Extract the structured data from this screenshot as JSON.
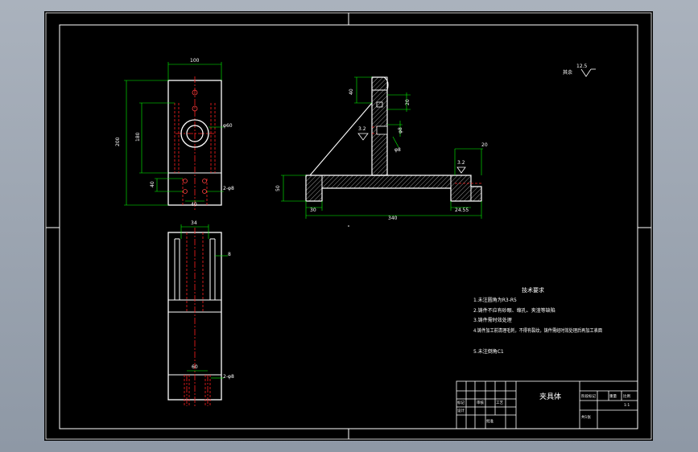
{
  "colors": {
    "paper": "#000000",
    "frame": "#ffffff",
    "outline": "#ffffff",
    "dimension": "#00ff00",
    "centerline": "#ff2020",
    "title_block": "#ffffff"
  },
  "views": {
    "top_view": {
      "dim_width": "100",
      "dim_height_outer": "200",
      "dim_height_inner": "180",
      "dim_bottom_offset": "40",
      "dim_hole_pitch": "40",
      "dim_bore": "φ60",
      "hole_note": "2-φ8"
    },
    "front_view": {
      "dim_top_width": "34",
      "dim_slot": "8",
      "dim_bottom_pitch": "60",
      "hole_note": "2-φ8"
    },
    "side_section": {
      "dim_top_height": "40",
      "dim_top_width": "20",
      "dim_right_height": "20",
      "dim_left_height": "50",
      "dim_left_width": "30",
      "dim_overall_length": "340",
      "dim_right_width": "24.55",
      "dim_hole_small": "φ8",
      "dim_bore_small": "φ8",
      "roughness_1": "3.2",
      "roughness_2": "3.2"
    }
  },
  "roughness_note": {
    "value": "12.5",
    "label": "其余"
  },
  "technical_requirements": {
    "title": "技术要求",
    "items": [
      "1.未注圆角为R3-R5",
      "2.铸件不应有砂眼、缩孔、夹渣等缺陷",
      "3.铸件需时效处理",
      "4.铸件加工前清理毛刺，不得有裂纹，铸件需经时效处理后再加工表面",
      "5.未注倒角C1"
    ]
  },
  "title_block": {
    "part_name": "夹具体",
    "left_rows": [
      "标记",
      "设计",
      "审核",
      "工艺",
      "批准"
    ],
    "right_headers": [
      "阶段标记",
      "重量",
      "比例"
    ],
    "scale": "1:1",
    "sheet": "共1张"
  }
}
